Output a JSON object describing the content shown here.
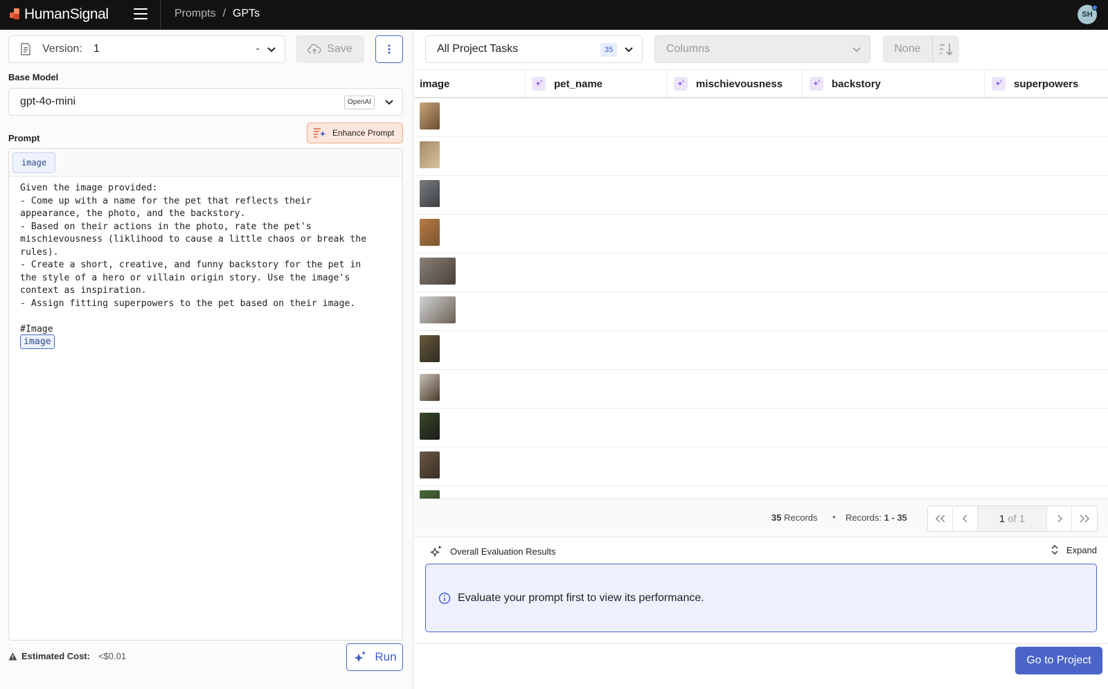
{
  "brand": {
    "name": "HumanSignal",
    "colors": {
      "accent": "#4a64c9",
      "brand": "#e8603c",
      "topbar": "#121212"
    }
  },
  "breadcrumb": {
    "section": "Prompts",
    "separator": "/",
    "current": "GPTs"
  },
  "user": {
    "initials": "SH"
  },
  "version": {
    "label": "Version:",
    "value": "1",
    "dash": "-"
  },
  "toolbar": {
    "save_label": "Save"
  },
  "base_model": {
    "label": "Base Model",
    "name": "gpt-4o-mini",
    "provider": "OpenAI"
  },
  "prompt": {
    "label": "Prompt",
    "enhance_label": "Enhance Prompt",
    "variables": [
      "image"
    ],
    "text": "Given the image provided:\n- Come up with a name for the pet that reflects their\nappearance, the photo, and the backstory.\n- Based on their actions in the photo, rate the pet's\nmischievousness (liklihood to cause a little chaos or break the\nrules).\n- Create a short, creative, and funny backstory for the pet in\nthe style of a hero or villain origin story. Use the image's\ncontext as inspiration.\n- Assign fitting superpowers to the pet based on their image.\n\n#Image",
    "inline_variable": "image"
  },
  "cost": {
    "label": "Estimated Cost:",
    "value": "<$0.01"
  },
  "run": {
    "label": "Run"
  },
  "tasks": {
    "select_label": "All Project Tasks",
    "count": "35"
  },
  "columns_select": {
    "placeholder": "Columns"
  },
  "sort": {
    "label": "None"
  },
  "table": {
    "columns": [
      "image",
      "pet_name",
      "mischievousness",
      "backstory",
      "superpowers"
    ],
    "rows": [
      {
        "thumb_colors": [
          "#c9a47a",
          "#6b4e2e"
        ],
        "wide": false
      },
      {
        "thumb_colors": [
          "#a88a6a",
          "#d6c39a"
        ],
        "wide": false
      },
      {
        "thumb_colors": [
          "#7a7d80",
          "#3c3e40"
        ],
        "wide": false
      },
      {
        "thumb_colors": [
          "#b77a44",
          "#7a5630"
        ],
        "wide": false
      },
      {
        "thumb_colors": [
          "#8a8078",
          "#4a4038"
        ],
        "wide": true
      },
      {
        "thumb_colors": [
          "#d0d4d8",
          "#6a6050"
        ],
        "wide": true
      },
      {
        "thumb_colors": [
          "#6a5a3a",
          "#2e2a22"
        ],
        "wide": false
      },
      {
        "thumb_colors": [
          "#c8c2b8",
          "#4a3a2a"
        ],
        "wide": false
      },
      {
        "thumb_colors": [
          "#3a4a2a",
          "#1a1a1a"
        ],
        "wide": false
      },
      {
        "thumb_colors": [
          "#6a5848",
          "#3a2e24"
        ],
        "wide": false
      },
      {
        "thumb_colors": [
          "#4a6a3a",
          "#2a3a22"
        ],
        "wide": false
      }
    ]
  },
  "records": {
    "count": "35",
    "count_label": "Records",
    "dot": "•",
    "range_label": "Records:",
    "range": "1 - 35"
  },
  "pager": {
    "page": "1",
    "of": "of 1"
  },
  "evaluation": {
    "title": "Overall Evaluation Results",
    "expand_label": "Expand",
    "message": "Evaluate your prompt first to view its performance."
  },
  "footer": {
    "goto_label": "Go to Project"
  }
}
